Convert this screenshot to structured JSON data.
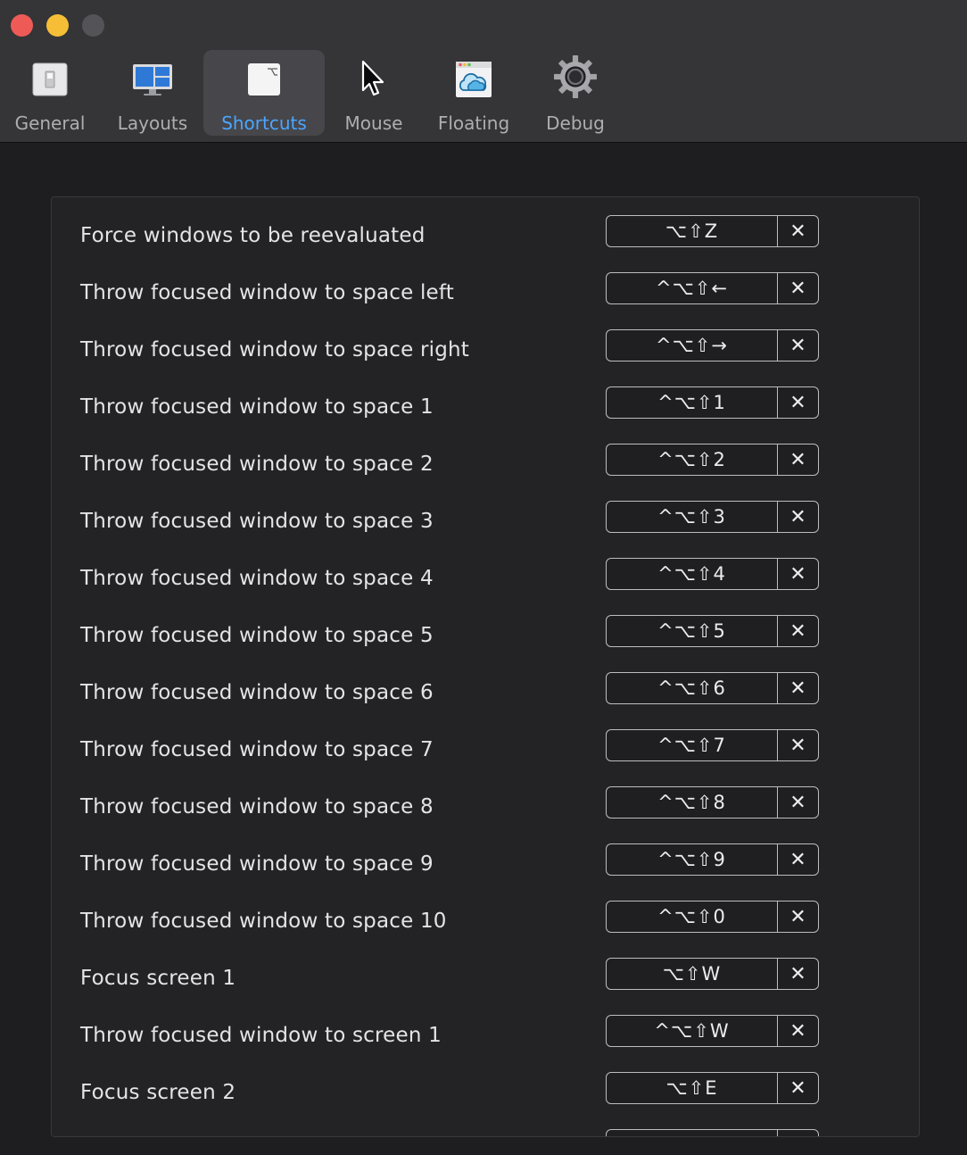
{
  "toolbar": {
    "tabs": [
      {
        "label": "General",
        "icon": "switch-icon"
      },
      {
        "label": "Layouts",
        "icon": "monitor-layout-icon"
      },
      {
        "label": "Shortcuts",
        "icon": "option-key-icon",
        "selected": true
      },
      {
        "label": "Mouse",
        "icon": "cursor-icon"
      },
      {
        "label": "Floating",
        "icon": "floating-window-icon"
      },
      {
        "label": "Debug",
        "icon": "gear-icon"
      }
    ],
    "selected_color": "#4aa6ff"
  },
  "shortcuts": {
    "clear_symbol": "✕",
    "rows": [
      {
        "label": "Force windows to be reevaluated",
        "keys": "⌥⇧Z"
      },
      {
        "label": "Throw focused window to space left",
        "keys": "^⌥⇧←"
      },
      {
        "label": "Throw focused window to space right",
        "keys": "^⌥⇧→"
      },
      {
        "label": "Throw focused window to space 1",
        "keys": "^⌥⇧1"
      },
      {
        "label": "Throw focused window to space 2",
        "keys": "^⌥⇧2"
      },
      {
        "label": "Throw focused window to space 3",
        "keys": "^⌥⇧3"
      },
      {
        "label": "Throw focused window to space 4",
        "keys": "^⌥⇧4"
      },
      {
        "label": "Throw focused window to space 5",
        "keys": "^⌥⇧5"
      },
      {
        "label": "Throw focused window to space 6",
        "keys": "^⌥⇧6"
      },
      {
        "label": "Throw focused window to space 7",
        "keys": "^⌥⇧7"
      },
      {
        "label": "Throw focused window to space 8",
        "keys": "^⌥⇧8"
      },
      {
        "label": "Throw focused window to space 9",
        "keys": "^⌥⇧9"
      },
      {
        "label": "Throw focused window to space 10",
        "keys": "^⌥⇧0"
      },
      {
        "label": "Focus screen 1",
        "keys": "⌥⇧W"
      },
      {
        "label": "Throw focused window to screen 1",
        "keys": "^⌥⇧W"
      },
      {
        "label": "Focus screen 2",
        "keys": "⌥⇧E"
      },
      {
        "label": "",
        "keys": ""
      }
    ]
  }
}
